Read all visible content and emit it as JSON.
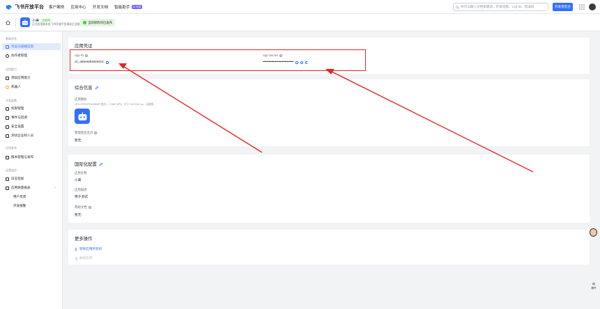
{
  "brand": {
    "name": "飞书开放平台"
  },
  "topnav": {
    "items": [
      "客户案例",
      "应用中心",
      "开发文档",
      "智能助手"
    ],
    "ai_badge": "AI 可用",
    "search_placeholder": "你可以输入文档关键词、开发问题、Log ID、错误码",
    "console_label": "开发者后台"
  },
  "app": {
    "name": "小美",
    "status_tag": "已启用",
    "company": "正式应用版本由飞书开放平台测试企业授权",
    "release_status": "当前修改均已发布"
  },
  "sidebar": {
    "groups": [
      {
        "title": "基础信息",
        "items": [
          {
            "label": "凭证与基础信息",
            "icon": "id-card-icon",
            "active": true
          },
          {
            "label": "协作者管理",
            "icon": "user-icon"
          }
        ]
      },
      {
        "title": "应用能力",
        "items": [
          {
            "label": "添加应用能力",
            "icon": "grid-plus-icon"
          },
          {
            "label": "机器人",
            "icon": "robot-icon"
          }
        ]
      },
      {
        "title": "开发配置",
        "items": [
          {
            "label": "权限管理",
            "icon": "key-icon"
          },
          {
            "label": "事件与回调",
            "icon": "event-icon"
          },
          {
            "label": "安全设置",
            "icon": "shield-icon"
          },
          {
            "label": "测试企业和人员",
            "icon": "test-icon"
          }
        ]
      },
      {
        "title": "应用发布",
        "items": [
          {
            "label": "版本管理与发布",
            "icon": "publish-icon"
          }
        ]
      },
      {
        "title": "运营监控",
        "items": [
          {
            "label": "日志检索",
            "icon": "log-icon"
          },
          {
            "label": "应用质量报表",
            "icon": "report-icon",
            "expanded": true
          },
          {
            "label": "用户反馈",
            "sub": true
          },
          {
            "label": "开发报警",
            "sub": true
          }
        ]
      }
    ]
  },
  "credentials": {
    "title": "应用凭证",
    "app_id_label": "App ID",
    "app_id_value": "cli_a65e6d0de9cb2",
    "app_secret_label": "App Secret",
    "app_secret_value": "••••••••••••••••••••••••••••••••"
  },
  "general": {
    "title": "综合信息",
    "icon_label": "应用图标",
    "icon_hint": "JPG/JPEG/PNG/BMP 格式，2 MB 以内，大于 240*240 px，无圆角",
    "bg_label": "管理后台主页",
    "bg_value": "暂无"
  },
  "i18n": {
    "title": "国际化配置",
    "name_label": "应用名称",
    "name_value": "小美",
    "desc_label": "应用描述",
    "desc_value": "用于测试",
    "help_label": "帮助文档",
    "help_value": "暂无"
  },
  "more": {
    "title": "更多操作",
    "transfer_label": "转移应用所有权",
    "delete_label": "删除应用"
  },
  "collapse_label": "展开",
  "colors": {
    "accent": "#3370ff",
    "annotation": "#e02828",
    "success": "#34c724"
  }
}
